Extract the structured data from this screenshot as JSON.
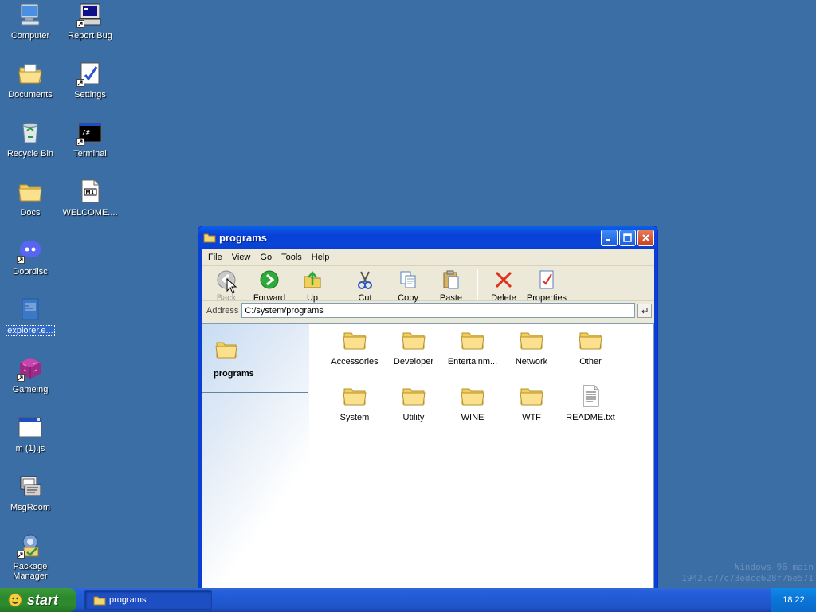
{
  "desktop": {
    "icons": [
      {
        "label": "Computer"
      },
      {
        "label": "Report Bug"
      },
      {
        "label": "Documents"
      },
      {
        "label": "Settings"
      },
      {
        "label": "Recycle Bin"
      },
      {
        "label": "Terminal"
      },
      {
        "label": "Docs"
      },
      {
        "label": "WELCOME...."
      },
      {
        "label": "Doordisc"
      },
      {
        "label": "explorer.e..."
      },
      {
        "label": "Gameing"
      },
      {
        "label": "m (1).js"
      },
      {
        "label": "MsgRoom"
      },
      {
        "label": "Package Manager"
      }
    ],
    "terminal_glyph": "/#",
    "markdown_glyph": "M⬇"
  },
  "window": {
    "title": "programs",
    "menu": [
      "File",
      "View",
      "Go",
      "Tools",
      "Help"
    ],
    "toolbar": {
      "back": "Back",
      "forward": "Forward",
      "up": "Up",
      "cut": "Cut",
      "copy": "Copy",
      "paste": "Paste",
      "delete": "Delete",
      "properties": "Properties"
    },
    "address": {
      "label": "Address",
      "value": "C:/system/programs"
    },
    "sidepane_title": "programs",
    "files": [
      {
        "name": "Accessories",
        "type": "folder"
      },
      {
        "name": "Developer",
        "type": "folder"
      },
      {
        "name": "Entertainm...",
        "type": "folder"
      },
      {
        "name": "Network",
        "type": "folder"
      },
      {
        "name": "Other",
        "type": "folder"
      },
      {
        "name": "System",
        "type": "folder"
      },
      {
        "name": "Utility",
        "type": "folder"
      },
      {
        "name": "WINE",
        "type": "folder"
      },
      {
        "name": "WTF",
        "type": "folder"
      },
      {
        "name": "README.txt",
        "type": "text-file"
      }
    ]
  },
  "taskbar": {
    "start_label": "start",
    "tasks": [
      {
        "label": "programs"
      }
    ],
    "clock": "18:22"
  },
  "watermark": {
    "line1": "Windows 96 main",
    "line2": "1942.d77c73edcc628f7be571"
  }
}
